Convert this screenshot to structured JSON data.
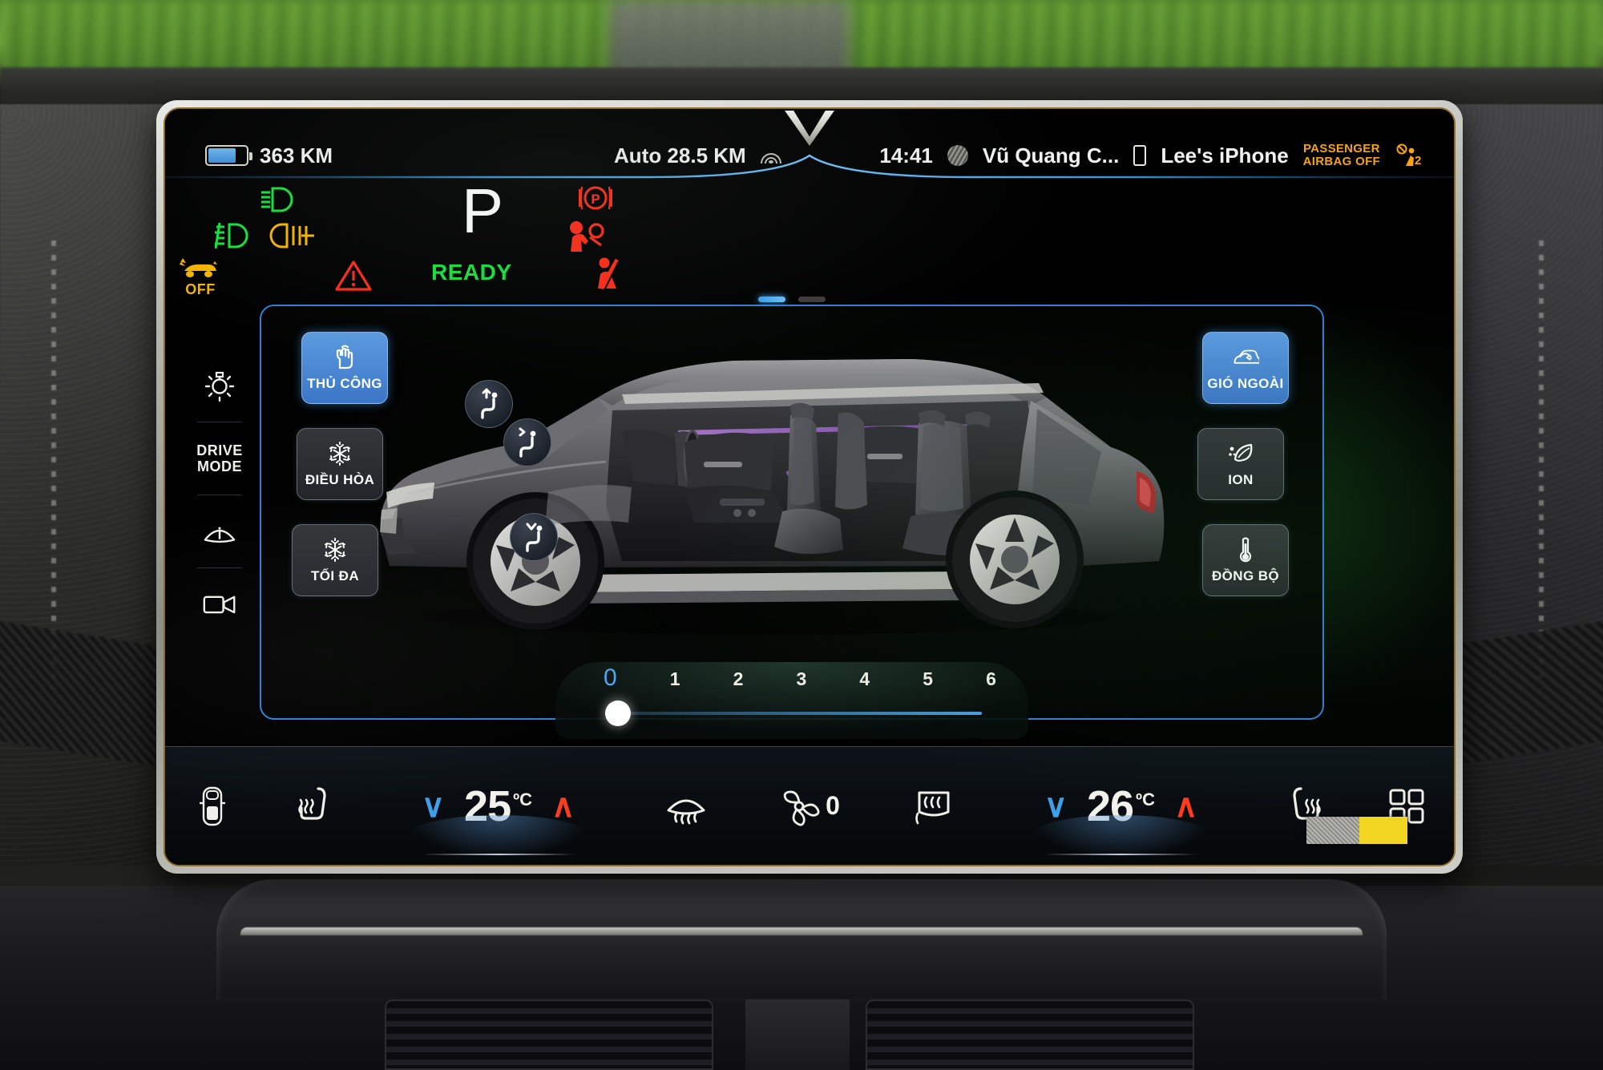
{
  "status_bar": {
    "range": "363 KM",
    "auto_range": "Auto 28.5 KM",
    "wifi_icon": "wifi-icon",
    "battery_icon": "battery-icon",
    "logo": "vinfast-v-logo",
    "time": "14:41",
    "media_source": "Vũ Quang C...",
    "media_icon": "media-disc-icon",
    "phone_icon": "phone-icon",
    "phone_name": "Lee's iPhone",
    "airbag_line1": "PASSENGER",
    "airbag_line2": "AIRBAG OFF",
    "occupant_icon": "passenger-airbag-off-icon",
    "occupant_label": "2"
  },
  "telltales": {
    "high_beam": "high-beam-icon",
    "front_fog": "front-fog-lamp-icon",
    "rear_fog": "rear-fog-lamp-icon",
    "traction_off_label": "OFF",
    "traction_icon": "traction-control-off-icon",
    "gear": "P",
    "master_warning": "master-warning-icon",
    "ready_label": "READY",
    "parking_brake": "parking-brake-icon",
    "airbag_warning": "airbag-warning-icon",
    "seatbelt_warning": "seatbelt-warning-icon"
  },
  "rail": {
    "items": [
      {
        "name": "brightness",
        "icon": "sun-brightness-icon",
        "label": ""
      },
      {
        "name": "drive-mode",
        "icon": "",
        "label": "DRIVE\nMODE",
        "label_line1": "DRIVE",
        "label_line2": "MODE"
      },
      {
        "name": "wiper",
        "icon": "wiper-info-icon",
        "label": ""
      },
      {
        "name": "camera",
        "icon": "camera-icon",
        "label": ""
      }
    ]
  },
  "climate": {
    "page_dots": {
      "total": 2,
      "active": 1
    },
    "left_buttons": [
      {
        "label": "THỦ CÔNG",
        "icon": "hand-touch-icon",
        "state": "on"
      },
      {
        "label": "ĐIỀU HÒA",
        "icon": "snowflake-icon",
        "state": "off"
      },
      {
        "label": "TỐI ĐA",
        "icon": "snowflake-icon",
        "state": "off"
      }
    ],
    "right_buttons": [
      {
        "label": "GIÓ NGOÀI",
        "icon": "fresh-air-recirculation-icon",
        "state": "on"
      },
      {
        "label": "ION",
        "icon": "ion-leaf-icon",
        "state": "off"
      },
      {
        "label": "ĐỒNG BỘ",
        "icon": "thermometer-sync-icon",
        "state": "off"
      }
    ],
    "airflow_buttons": [
      {
        "name": "airflow-face",
        "direction": "face"
      },
      {
        "name": "airflow-face-feet",
        "direction": "face-feet"
      },
      {
        "name": "airflow-feet",
        "direction": "feet"
      }
    ],
    "fan_slider": {
      "ticks": [
        "0",
        "1",
        "2",
        "3",
        "4",
        "5",
        "6"
      ],
      "value": 0,
      "min": 0,
      "max": 6
    }
  },
  "bottom_bar": {
    "car_view_icon": "car-top-view-icon",
    "driver_seat_heat_icon": "seat-heater-icon",
    "driver_temp_down": "∨",
    "driver_temp_value": "25",
    "driver_temp_unit": "ºC",
    "driver_temp_up": "∧",
    "front_defrost_icon": "front-defrost-icon",
    "fan_icon": "fan-icon",
    "fan_value": "0",
    "rear_defrost_icon": "rear-defrost-icon",
    "passenger_temp_down": "∨",
    "passenger_temp_value": "26",
    "passenger_temp_unit": "ºC",
    "passenger_temp_up": "∧",
    "passenger_seat_heat_icon": "seat-heater-icon",
    "apps_grid_icon": "apps-grid-icon"
  },
  "colors": {
    "accent_blue": "#3f9fe8",
    "button_on_blue": "#4e87d3",
    "panel_border": "#2f7fd4",
    "green": "#15e23c",
    "red": "#ff2a18",
    "amber": "#f6a314",
    "hot_red": "#ff3b20"
  }
}
